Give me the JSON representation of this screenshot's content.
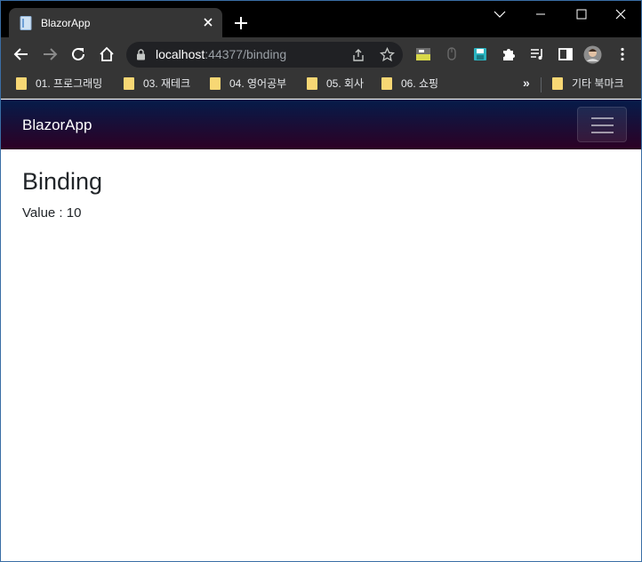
{
  "browser": {
    "tab_title": "BlazorApp",
    "url_host": "localhost",
    "url_path": ":44377/binding"
  },
  "bookmarks": {
    "items": [
      {
        "label": "01. 프로그래밍"
      },
      {
        "label": "03. 재테크"
      },
      {
        "label": "04. 영어공부"
      },
      {
        "label": "05. 회사"
      },
      {
        "label": "06. 쇼핑"
      }
    ],
    "overflow_label": "»",
    "other_label": "기타 북마크"
  },
  "app": {
    "brand": "BlazorApp",
    "page_title": "Binding",
    "value_label": "Value : ",
    "value": "10"
  },
  "colors": {
    "navbar_top": "#051c4a",
    "navbar_bottom": "#2d0024",
    "browser_chrome": "#353535"
  }
}
